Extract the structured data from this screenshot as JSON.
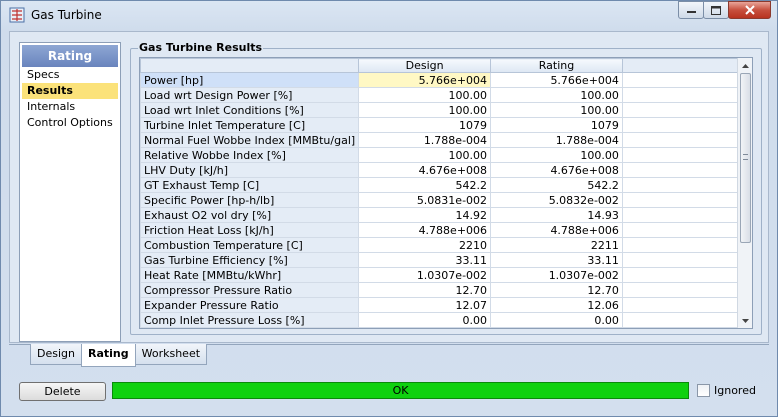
{
  "window": {
    "title": "Gas Turbine"
  },
  "nav": {
    "header": "Rating",
    "items": [
      "Specs",
      "Results",
      "Internals",
      "Control Options"
    ],
    "selected": "Results"
  },
  "results": {
    "title": "Gas Turbine Results",
    "columns": [
      "Design",
      "Rating"
    ],
    "rows": [
      {
        "label": "Power [hp]",
        "design": "5.766e+004",
        "rating": "5.766e+004"
      },
      {
        "label": "Load wrt Design Power [%]",
        "design": "100.00",
        "rating": "100.00"
      },
      {
        "label": "Load wrt Inlet Conditions [%]",
        "design": "100.00",
        "rating": "100.00"
      },
      {
        "label": "Turbine Inlet Temperature [C]",
        "design": "1079",
        "rating": "1079"
      },
      {
        "label": "Normal Fuel Wobbe Index [MMBtu/gal]",
        "design": "1.788e-004",
        "rating": "1.788e-004"
      },
      {
        "label": "Relative Wobbe Index [%]",
        "design": "100.00",
        "rating": "100.00"
      },
      {
        "label": "LHV Duty [kJ/h]",
        "design": "4.676e+008",
        "rating": "4.676e+008"
      },
      {
        "label": "GT Exhaust Temp [C]",
        "design": "542.2",
        "rating": "542.2"
      },
      {
        "label": "Specific Power [hp-h/lb]",
        "design": "5.0831e-002",
        "rating": "5.0832e-002"
      },
      {
        "label": "Exhaust O2 vol dry [%]",
        "design": "14.92",
        "rating": "14.93"
      },
      {
        "label": "Friction Heat Loss [kJ/h]",
        "design": "4.788e+006",
        "rating": "4.788e+006"
      },
      {
        "label": "Combustion Temperature [C]",
        "design": "2210",
        "rating": "2211"
      },
      {
        "label": "Gas Turbine Efficiency [%]",
        "design": "33.11",
        "rating": "33.11"
      },
      {
        "label": "Heat Rate [MMBtu/kWhr]",
        "design": "1.0307e-002",
        "rating": "1.0307e-002"
      },
      {
        "label": "Compressor Pressure Ratio",
        "design": "12.70",
        "rating": "12.70"
      },
      {
        "label": "Expander Pressure Ratio",
        "design": "12.07",
        "rating": "12.06"
      },
      {
        "label": "Comp Inlet Pressure Loss [%]",
        "design": "0.00",
        "rating": "0.00"
      }
    ]
  },
  "tabs": [
    "Design",
    "Rating",
    "Worksheet"
  ],
  "active_tab": "Rating",
  "footer": {
    "delete_label": "Delete",
    "status_text": "OK",
    "status_color": "#0fd10f",
    "ignored_label": "Ignored"
  }
}
